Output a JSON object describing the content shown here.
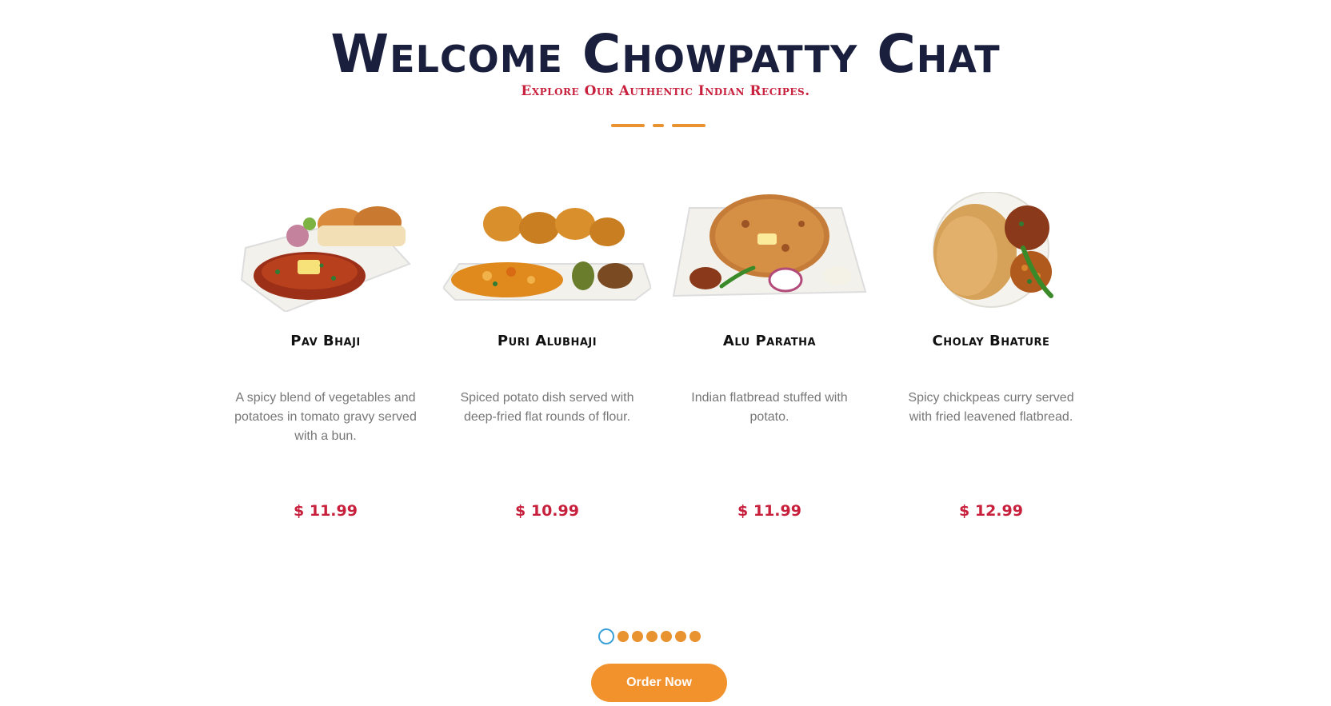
{
  "header": {
    "title": "Welcome Chowpatty Chat",
    "subtitle": "Explore Our Authentic Indian Recipes."
  },
  "menu": {
    "items": [
      {
        "name": "Pav Bhaji",
        "description": "A spicy blend of vegetables and potatoes in tomato gravy served with a bun.",
        "price": "$ 11.99"
      },
      {
        "name": "Puri Alubhaji",
        "description": "Spiced potato dish served with deep-fried flat rounds of flour.",
        "price": "$ 10.99"
      },
      {
        "name": "Alu Paratha",
        "description": "Indian flatbread stuffed with potato.",
        "price": "$ 11.99"
      },
      {
        "name": "Cholay Bhature",
        "description": "Spicy chickpeas curry served with fried leavened flatbread.",
        "price": "$ 12.99"
      }
    ]
  },
  "carousel": {
    "page_count": 7,
    "active_index": 0
  },
  "cta": {
    "order_label": "Order Now"
  },
  "colors": {
    "title": "#1a1f3d",
    "accent_red": "#c8213d",
    "accent_orange": "#f1922d",
    "active_dot": "#3aa0d8"
  }
}
